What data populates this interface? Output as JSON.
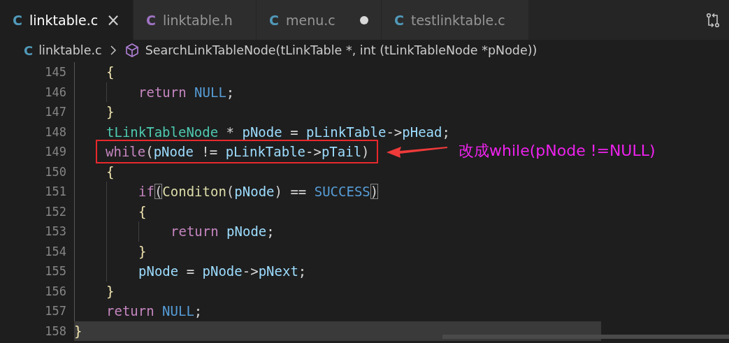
{
  "tabs": [
    {
      "icon": "C",
      "color": "#519aba",
      "label": "linktable.c",
      "selected": true,
      "close": "×",
      "modified": false
    },
    {
      "icon": "C",
      "color": "#a074c4",
      "label": "linktable.h",
      "selected": false,
      "modified": false
    },
    {
      "icon": "C",
      "color": "#519aba",
      "label": "menu.c",
      "selected": false,
      "modified": true
    },
    {
      "icon": "C",
      "color": "#519aba",
      "label": "testlinktable.c",
      "selected": false,
      "modified": false
    }
  ],
  "breadcrumb": {
    "file_icon": "C",
    "file": "linktable.c",
    "symbol": "SearchLinkTableNode(tLinkTable *, int (tLinkTableNode *pNode))"
  },
  "editor": {
    "body": [
      {
        "number": "145",
        "current": false,
        "tokens": [
          {
            "kind": "brace",
            "text": "{"
          }
        ],
        "children": [
          {
            "number": "146",
            "current": false,
            "tokens": [
              {
                "kind": "keyword",
                "text": "return"
              },
              {
                "kind": "const",
                "text": " NULL"
              },
              {
                "kind": "punct",
                "text": ";"
              }
            ]
          }
        ]
      },
      {
        "number": "147",
        "current": false,
        "tokens": [
          {
            "kind": "brace",
            "text": "}"
          }
        ]
      },
      {
        "number": "148",
        "current": false,
        "tokens": [
          {
            "kind": "type",
            "text": "tLinkTableNode"
          },
          {
            "kind": "punct",
            "text": " * "
          },
          {
            "kind": "var",
            "text": "pNode"
          },
          {
            "kind": "punct",
            "text": " = "
          },
          {
            "kind": "var",
            "text": "pLinkTable"
          },
          {
            "kind": "punct",
            "text": "->"
          },
          {
            "kind": "var",
            "text": "pHead"
          },
          {
            "kind": "punct",
            "text": ";"
          }
        ]
      },
      {
        "number": "149",
        "current": false,
        "tokens": [
          {
            "kind": "keyword",
            "text": "while"
          },
          {
            "kind": "punct",
            "text": "("
          },
          {
            "kind": "var",
            "text": "pNode"
          },
          {
            "kind": "punct",
            "text": " != "
          },
          {
            "kind": "var",
            "text": "pLinkTable"
          },
          {
            "kind": "punct",
            "text": "->"
          },
          {
            "kind": "var",
            "text": "pTail"
          },
          {
            "kind": "punct",
            "text": ")"
          }
        ],
        "annotation": "改成while(pNode !=NULL)"
      },
      {
        "number": "150",
        "current": false,
        "tokens": [
          {
            "kind": "brace",
            "text": "{"
          }
        ],
        "children": [
          {
            "number": "151",
            "current": false,
            "tokens": [
              {
                "kind": "keyword",
                "text": "if"
              },
              {
                "kind": "match",
                "text": "("
              },
              {
                "kind": "func",
                "text": "Conditon"
              },
              {
                "kind": "punct",
                "text": "("
              },
              {
                "kind": "var",
                "text": "pNode"
              },
              {
                "kind": "punct",
                "text": ") == "
              },
              {
                "kind": "const",
                "text": "SUCCESS"
              },
              {
                "kind": "match",
                "text": ")"
              }
            ]
          },
          {
            "number": "152",
            "current": false,
            "tokens": [
              {
                "kind": "brace",
                "text": "{"
              }
            ],
            "children": [
              {
                "number": "153",
                "current": false,
                "tokens": [
                  {
                    "kind": "keyword",
                    "text": "return"
                  },
                  {
                    "kind": "var",
                    "text": " pNode"
                  },
                  {
                    "kind": "punct",
                    "text": ";"
                  }
                ]
              }
            ]
          },
          {
            "number": "154",
            "current": false,
            "tokens": [
              {
                "kind": "brace",
                "text": "}"
              }
            ]
          },
          {
            "number": "155",
            "current": false,
            "tokens": [
              {
                "kind": "var",
                "text": "pNode"
              },
              {
                "kind": "punct",
                "text": " = "
              },
              {
                "kind": "var",
                "text": "pNode"
              },
              {
                "kind": "punct",
                "text": "->"
              },
              {
                "kind": "var",
                "text": "pNext"
              },
              {
                "kind": "punct",
                "text": ";"
              }
            ]
          }
        ]
      },
      {
        "number": "156",
        "current": false,
        "tokens": [
          {
            "kind": "brace",
            "text": "}"
          }
        ]
      },
      {
        "number": "157",
        "current": false,
        "tokens": [
          {
            "kind": "keyword",
            "text": "return"
          },
          {
            "kind": "const",
            "text": " NULL"
          },
          {
            "kind": "punct",
            "text": ";"
          }
        ]
      }
    ],
    "end": {
      "number": "158",
      "current": true,
      "tokens": [
        {
          "kind": "brace",
          "text": "}"
        }
      ]
    }
  }
}
